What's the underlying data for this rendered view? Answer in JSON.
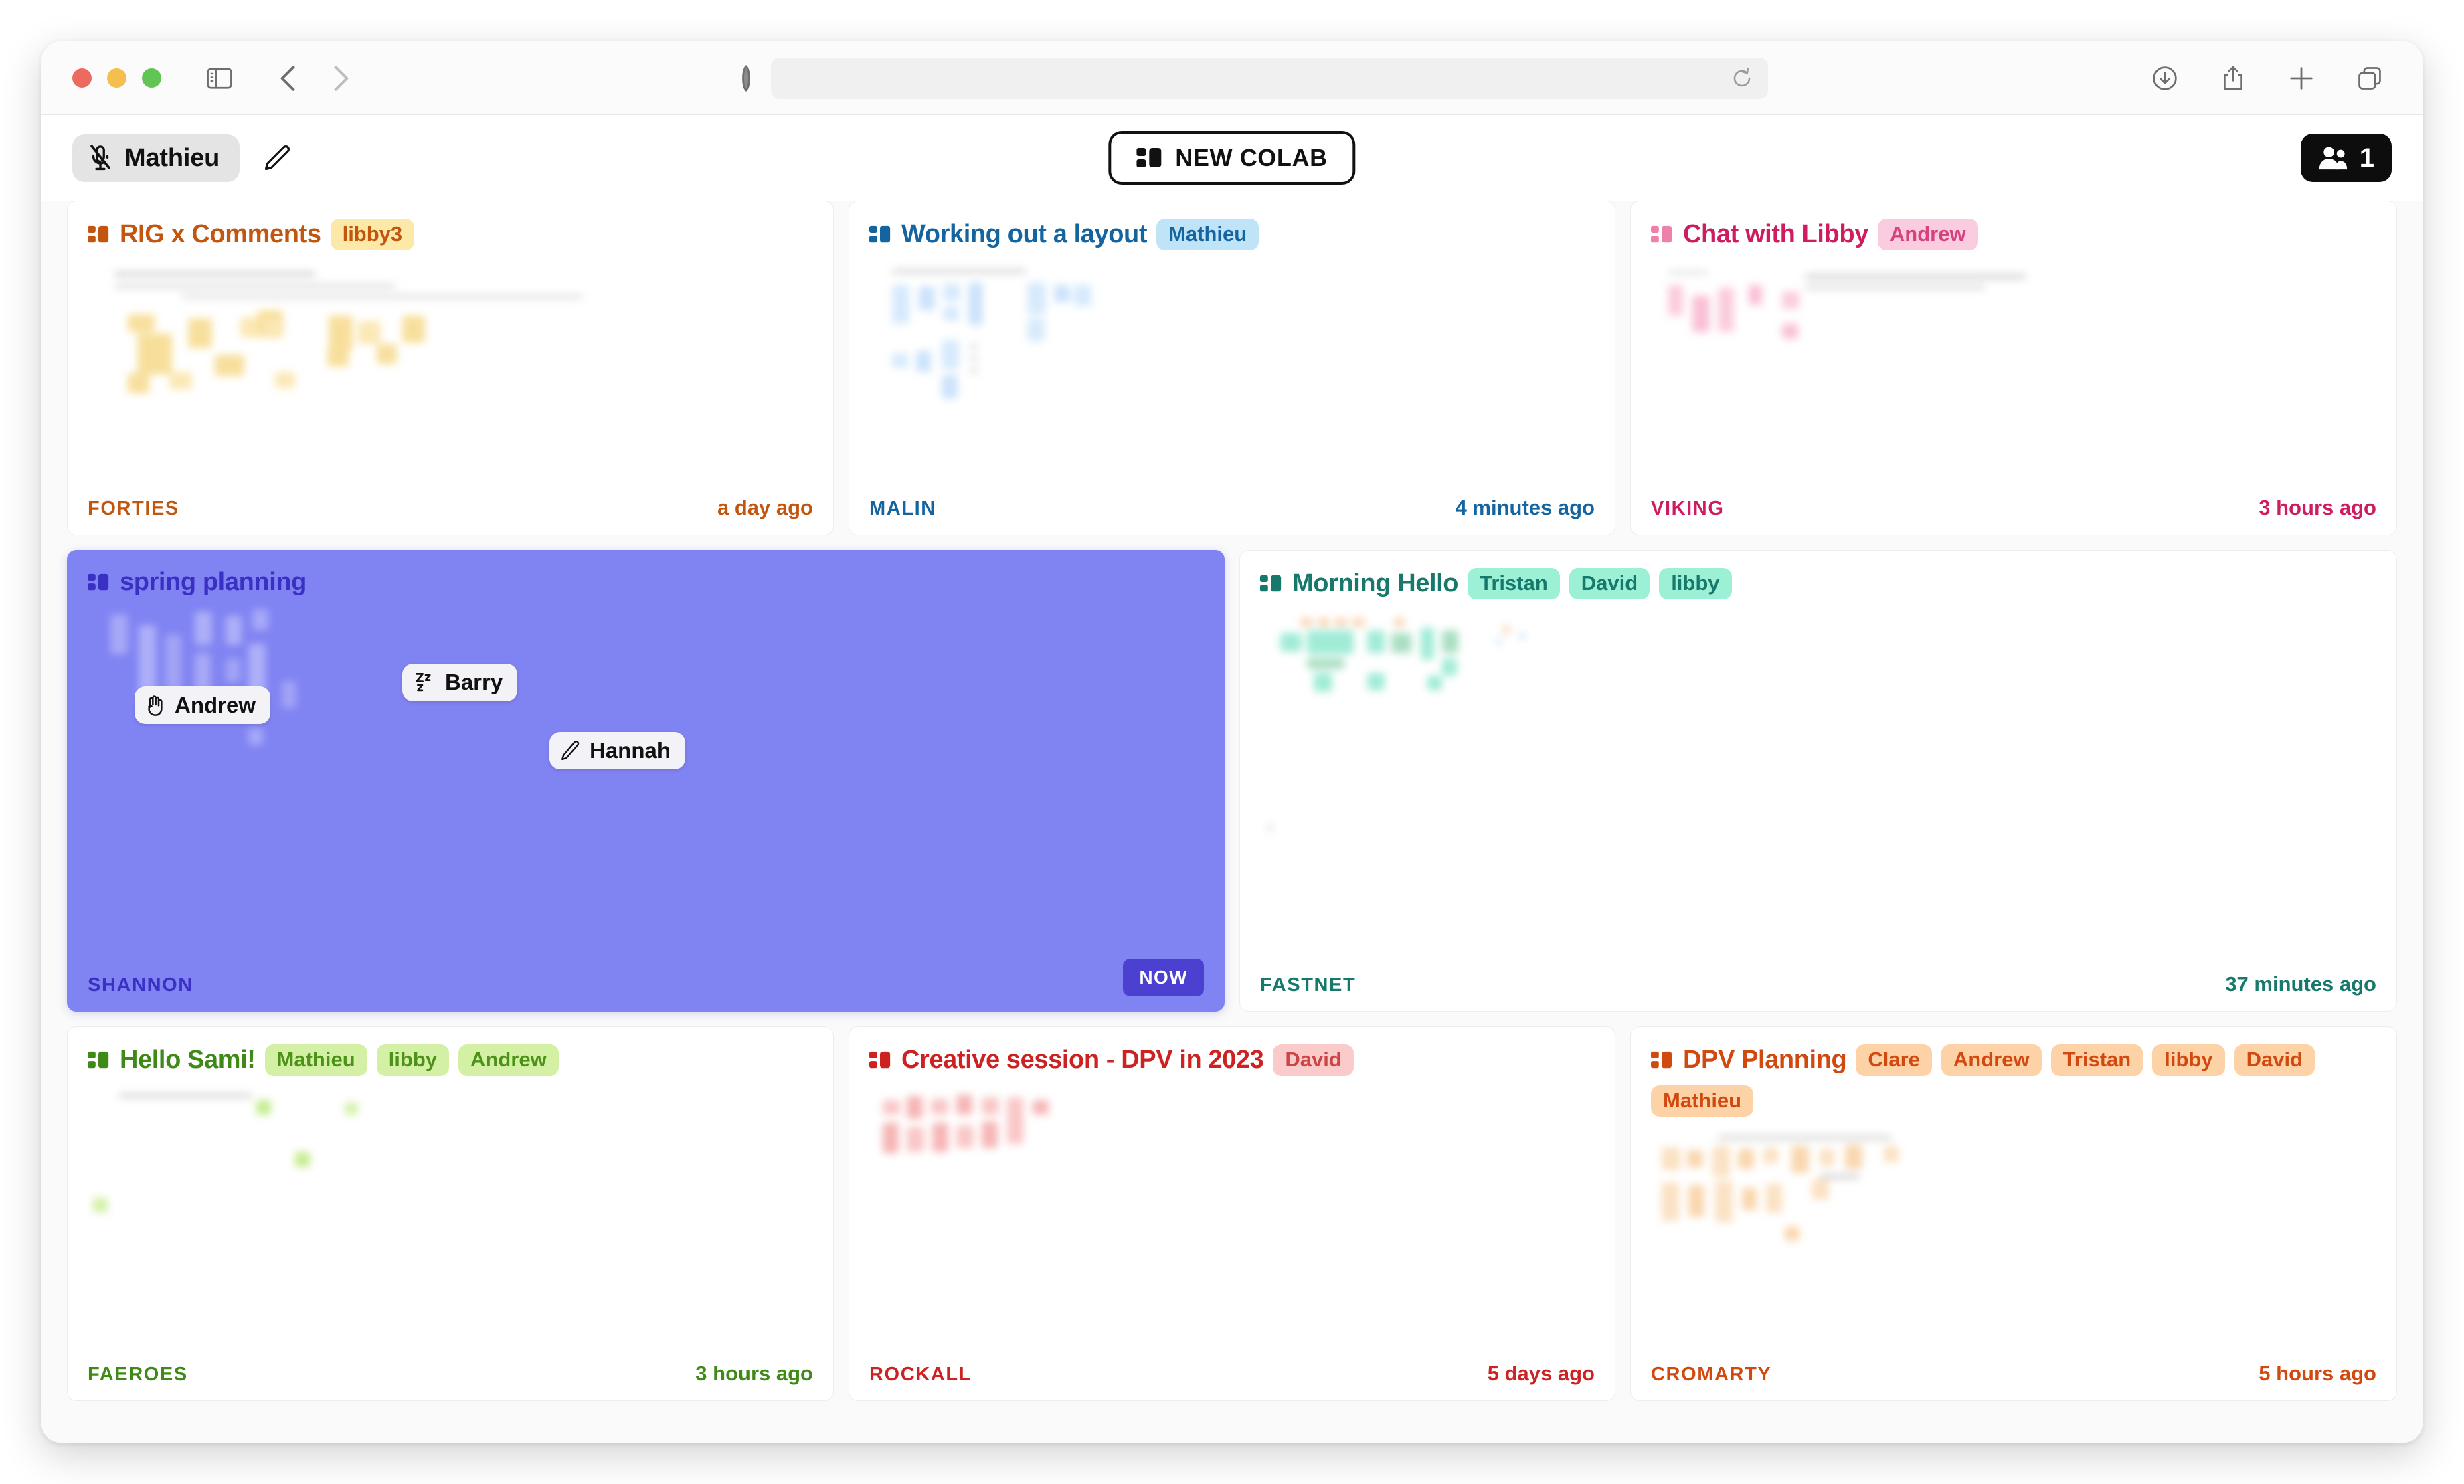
{
  "browser": {
    "url_value": "",
    "url_placeholder": "",
    "traffic_lights": [
      "close",
      "minimize",
      "maximize"
    ],
    "icons": {
      "sidebar": "sidebar-toggle-icon",
      "back": "back-chevron-icon",
      "forward": "forward-chevron-icon",
      "shield": "privacy-shield-icon",
      "reload": "reload-icon",
      "downloads": "downloads-icon",
      "share": "share-icon",
      "new_tab": "plus-icon",
      "tabs": "tab-overview-icon"
    }
  },
  "header": {
    "user_name": "Mathieu",
    "mic_state": "muted",
    "edit_label": "edit",
    "new_colab_label": "NEW COLAB",
    "participants_count": "1"
  },
  "cards": [
    {
      "id": "rig-x-comments",
      "title": "RIG x Comments",
      "chips": [
        "libby3"
      ],
      "footer_name": "FORTIES",
      "footer_time": "a day ago",
      "accent": "#c2560f",
      "chip_bg": "#fce9a8",
      "chip_fg": "#c2560f",
      "thumb_color": "#f6d98a",
      "highlight": false
    },
    {
      "id": "working-out-a-layout",
      "title": "Working out a layout",
      "chips": [
        "Mathieu"
      ],
      "footer_name": "MALIN",
      "footer_time": "4 minutes ago",
      "accent": "#1464a0",
      "chip_bg": "#bfe4f8",
      "chip_fg": "#1464a0",
      "thumb_color": "#b9dcf5",
      "highlight": false
    },
    {
      "id": "chat-with-libby",
      "title": "Chat with Libby",
      "chips": [
        "Andrew"
      ],
      "footer_name": "VIKING",
      "footer_time": "3 hours ago",
      "accent": "#cf1b5f",
      "chip_bg": "#fbcbe0",
      "chip_fg": "#d4437d",
      "thumb_color": "#fac3d7",
      "highlight": false
    },
    {
      "id": "spring-planning",
      "title": "spring planning",
      "chips": [],
      "footer_name": "SHANNON",
      "footer_time": "NOW",
      "accent": "#3b30c4",
      "chip_bg": "#6f72e8",
      "chip_fg": "#ffffff",
      "thumb_color": "#a9abf7",
      "highlight": true,
      "presence": [
        {
          "name": "Andrew",
          "icon": "hand-raised-icon"
        },
        {
          "name": "Barry",
          "icon": "sleeping-zzz-icon"
        },
        {
          "name": "Hannah",
          "icon": "pencil-icon"
        }
      ]
    },
    {
      "id": "morning-hello",
      "title": "Morning Hello",
      "chips": [
        "Tristan",
        "David",
        "libby"
      ],
      "footer_name": "FASTNET",
      "footer_time": "37 minutes ago",
      "accent": "#16796b",
      "chip_bg": "#9cf0d6",
      "chip_fg": "#16796b",
      "thumb_color": "#8fe8d0",
      "highlight": false
    },
    {
      "id": "hello-sami",
      "title": "Hello Sami!",
      "chips": [
        "Mathieu",
        "libby",
        "Andrew"
      ],
      "footer_name": "FAEROES",
      "footer_time": "3 hours ago",
      "accent": "#3f8a16",
      "chip_bg": "#d4f0a5",
      "chip_fg": "#4c9118",
      "thumb_color": "#b9e978",
      "highlight": false
    },
    {
      "id": "creative-session-dpv-2023",
      "title": "Creative session - DPV in 2023",
      "chips": [
        "David"
      ],
      "footer_name": "ROCKALL",
      "footer_time": "5 days ago",
      "accent": "#cc2222",
      "chip_bg": "#fbcaca",
      "chip_fg": "#cc4444",
      "thumb_color": "#f8bdbd",
      "highlight": false
    },
    {
      "id": "dpv-planning",
      "title": "DPV Planning",
      "chips": [
        "Clare",
        "Andrew",
        "Tristan",
        "libby",
        "David",
        "Mathieu"
      ],
      "footer_name": "CROMARTY",
      "footer_time": "5 hours ago",
      "accent": "#d2490f",
      "chip_bg": "#fcd2a6",
      "chip_fg": "#d2490f",
      "thumb_color": "#fadcb8",
      "highlight": false
    }
  ]
}
